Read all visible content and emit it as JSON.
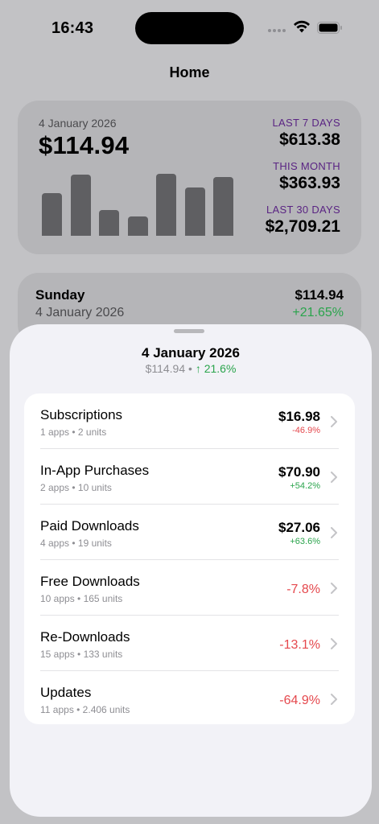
{
  "status_bar": {
    "time": "16:43"
  },
  "nav": {
    "title": "Home"
  },
  "summary": {
    "date": "4 January 2026",
    "amount": "$114.94",
    "bars": [
      0.62,
      0.88,
      0.37,
      0.28,
      0.89,
      0.7,
      0.85
    ],
    "stats": [
      {
        "label": "LAST 7 DAYS",
        "value": "$613.38"
      },
      {
        "label": "THIS MONTH",
        "value": "$363.93"
      },
      {
        "label": "LAST 30 DAYS",
        "value": "$2,709.21"
      }
    ],
    "accent_color": "#5a2483"
  },
  "day": {
    "name": "Sunday",
    "date": "4 January 2026",
    "amount": "$114.94",
    "change": "+21.65%"
  },
  "sheet": {
    "title": "4 January 2026",
    "subtitle_amount": "$114.94",
    "subtitle_sep": "•",
    "subtitle_change": "↑ 21.6%",
    "rows": [
      {
        "title": "Subscriptions",
        "meta": "1 apps • 2 units",
        "amount": "$16.98",
        "change": "-46.9%",
        "trend": "neg"
      },
      {
        "title": "In-App Purchases",
        "meta": "2 apps • 10 units",
        "amount": "$70.90",
        "change": "+54.2%",
        "trend": "pos"
      },
      {
        "title": "Paid Downloads",
        "meta": "4 apps • 19 units",
        "amount": "$27.06",
        "change": "+63.6%",
        "trend": "pos"
      },
      {
        "title": "Free Downloads",
        "meta": "10 apps • 165 units",
        "amount": "",
        "change": "-7.8%",
        "trend": "neg"
      },
      {
        "title": "Re-Downloads",
        "meta": "15 apps • 133 units",
        "amount": "",
        "change": "-13.1%",
        "trend": "neg"
      },
      {
        "title": "Updates",
        "meta": "11 apps • 2.406 units",
        "amount": "",
        "change": "-64.9%",
        "trend": "neg"
      }
    ]
  },
  "colors": {
    "positive": "#2aa44c",
    "negative": "#e5484d"
  }
}
